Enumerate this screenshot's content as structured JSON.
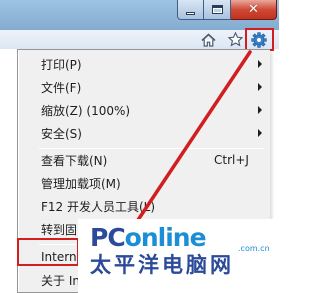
{
  "window": {
    "controls": {
      "minimize_icon": "minimize-icon",
      "maximize_icon": "maximize-icon",
      "close_glyph": "✕"
    }
  },
  "toolbar": {
    "icons": [
      "home-icon",
      "star-icon",
      "gear-icon"
    ]
  },
  "menu": {
    "items": [
      {
        "label": "打印(P)",
        "submenu": true
      },
      {
        "label": "文件(F)",
        "submenu": true
      },
      {
        "label": "缩放(Z) (100%)",
        "submenu": true
      },
      {
        "label": "安全(S)",
        "submenu": true
      },
      {
        "label": "查看下载(N)",
        "shortcut": "Ctrl+J"
      },
      {
        "label": "管理加载项(M)"
      },
      {
        "label": "F12 开发人员工具(L)"
      },
      {
        "label": "转到固"
      },
      {
        "label": "Interne"
      },
      {
        "label": "关于 In"
      }
    ]
  },
  "annotation": {
    "color": "#d21e1e"
  },
  "watermark": {
    "brand_p": "PC",
    "brand_rest": "online",
    "domain": ".com.cn",
    "chinese": "太平洋电脑网"
  },
  "colors": {
    "menu_bg": "#f0f0f0",
    "titlebar": "#9fc3e4",
    "highlight": "#d21e1e",
    "brand_blue": "#2b4a99"
  }
}
